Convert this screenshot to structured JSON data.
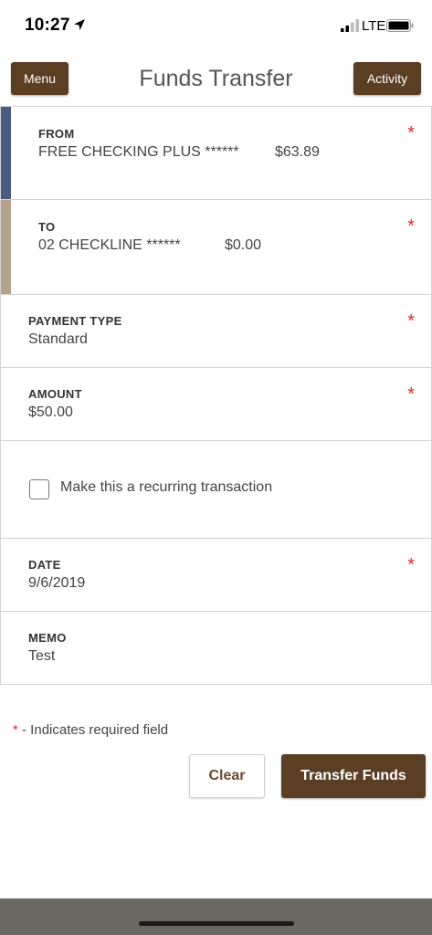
{
  "status_bar": {
    "time": "10:27",
    "network": "LTE"
  },
  "header": {
    "menu_label": "Menu",
    "title": "Funds Transfer",
    "activity_label": "Activity"
  },
  "form": {
    "from": {
      "label": "FROM",
      "account": "FREE CHECKING PLUS ******",
      "balance": "$63.89",
      "accent_color": "#4a5b82"
    },
    "to": {
      "label": "TO",
      "account": "02 CHECKLINE ******",
      "balance": "$0.00",
      "accent_color": "#b4a28c"
    },
    "payment_type": {
      "label": "PAYMENT TYPE",
      "value": "Standard"
    },
    "amount": {
      "label": "AMOUNT",
      "value": "$50.00"
    },
    "recurring": {
      "label": "Make this a recurring transaction",
      "checked": false
    },
    "date": {
      "label": "DATE",
      "value": "9/6/2019"
    },
    "memo": {
      "label": "MEMO",
      "value": "Test"
    },
    "required_marker": "*"
  },
  "footer": {
    "required_note": "- Indicates required field",
    "clear_label": "Clear",
    "transfer_label": "Transfer Funds"
  },
  "colors": {
    "brand": "#5b3f24",
    "required": "#e02a2a"
  }
}
